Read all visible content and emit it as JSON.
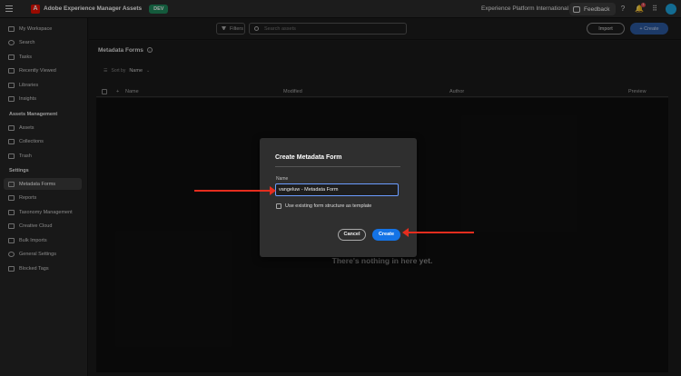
{
  "topbar": {
    "app_name": "Adobe Experience Manager Assets",
    "env_badge": "DEV",
    "org_name": "Experience Platform International",
    "feedback_label": "Feedback",
    "notification_count": "1"
  },
  "sidebar": {
    "items_top": [
      {
        "label": "My Workspace"
      },
      {
        "label": "Search"
      },
      {
        "label": "Tasks"
      },
      {
        "label": "Recently Viewed"
      },
      {
        "label": "Libraries"
      },
      {
        "label": "Insights"
      }
    ],
    "section_assets": "Assets Management",
    "items_assets": [
      {
        "label": "Assets"
      },
      {
        "label": "Collections"
      },
      {
        "label": "Trash"
      }
    ],
    "section_settings": "Settings",
    "items_settings": [
      {
        "label": "Metadata Forms"
      },
      {
        "label": "Reports"
      },
      {
        "label": "Taxonomy Management"
      },
      {
        "label": "Creative Cloud"
      },
      {
        "label": "Bulk Imports"
      },
      {
        "label": "General Settings"
      },
      {
        "label": "Blocked Tags"
      }
    ]
  },
  "toolbar": {
    "filters_label": "Filters",
    "search_placeholder": "Search assets",
    "import_label": "Import",
    "create_label": "Create"
  },
  "main": {
    "title": "Metadata Forms",
    "sort_by_label": "Sort by",
    "sort_by_value": "Name",
    "columns": [
      "Name",
      "Modified",
      "Author",
      "Preview"
    ],
    "empty_message": "There's nothing in here yet."
  },
  "dialog": {
    "title": "Create Metadata Form",
    "name_label": "Name",
    "name_value": "vangeluw - Metadata Form",
    "checkbox_label": "Use existing form structure as template",
    "cancel_label": "Cancel",
    "create_label": "Create"
  },
  "colors": {
    "accent": "#1473e6",
    "annotation_arrow": "#e52d1e",
    "adobe_red": "#eb1000",
    "env_badge": "#1f8a5d"
  }
}
